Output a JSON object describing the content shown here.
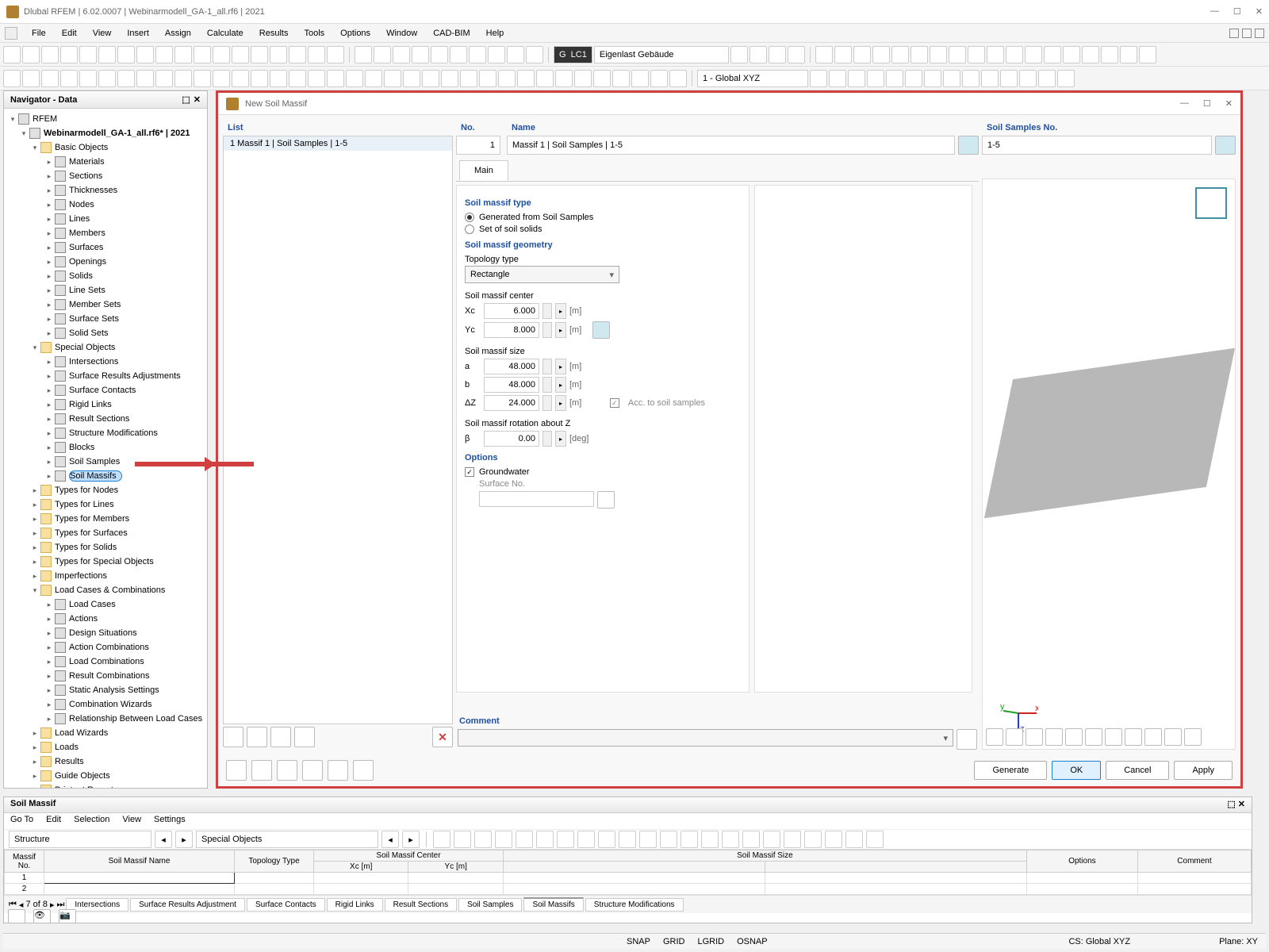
{
  "titlebar": {
    "text": "Dlubal RFEM | 6.02.0007 | Webinarmodell_GA-1_all.rf6 | 2021"
  },
  "menu": {
    "items": [
      "File",
      "Edit",
      "View",
      "Insert",
      "Assign",
      "Calculate",
      "Results",
      "Tools",
      "Options",
      "Window",
      "CAD-BIM",
      "Help"
    ]
  },
  "toolbar1": {
    "lc": "LC1",
    "lc_name": "Eigenlast Gebäude",
    "global": "1 - Global XYZ"
  },
  "navigator": {
    "title": "Navigator - Data",
    "root": "RFEM",
    "model": "Webinarmodell_GA-1_all.rf6* | 2021",
    "groups": {
      "basic": {
        "label": "Basic Objects",
        "items": [
          "Materials",
          "Sections",
          "Thicknesses",
          "Nodes",
          "Lines",
          "Members",
          "Surfaces",
          "Openings",
          "Solids",
          "Line Sets",
          "Member Sets",
          "Surface Sets",
          "Solid Sets"
        ]
      },
      "special": {
        "label": "Special Objects",
        "items": [
          "Intersections",
          "Surface Results Adjustments",
          "Surface Contacts",
          "Rigid Links",
          "Result Sections",
          "Structure Modifications",
          "Blocks",
          "Soil Samples"
        ],
        "selected": "Soil Massifs"
      },
      "types": [
        "Types for Nodes",
        "Types for Lines",
        "Types for Members",
        "Types for Surfaces",
        "Types for Solids",
        "Types for Special Objects",
        "Imperfections"
      ],
      "loadcomb": {
        "label": "Load Cases & Combinations",
        "items": [
          "Load Cases",
          "Actions",
          "Design Situations",
          "Action Combinations",
          "Load Combinations",
          "Result Combinations",
          "Static Analysis Settings",
          "Combination Wizards",
          "Relationship Between Load Cases"
        ]
      },
      "other": [
        "Load Wizards",
        "Loads",
        "Results",
        "Guide Objects",
        "Printout Reports"
      ]
    }
  },
  "dialog": {
    "title": "New Soil Massif",
    "list_header": "List",
    "list_item": "1  Massif 1 | Soil Samples | 1-5",
    "no_label": "No.",
    "no_value": "1",
    "name_label": "Name",
    "name_value": "Massif 1 | Soil Samples | 1-5",
    "samples_label": "Soil Samples No.",
    "samples_value": "1-5",
    "tab_main": "Main",
    "sec_type": "Soil massif type",
    "radio_gen": "Generated from Soil Samples",
    "radio_set": "Set of soil solids",
    "sec_geom": "Soil massif geometry",
    "topo_label": "Topology type",
    "topo_value": "Rectangle",
    "center_label": "Soil massif center",
    "xc_label": "Xc",
    "xc": "6.000",
    "yc_label": "Yc",
    "yc": "8.000",
    "size_label": "Soil massif size",
    "a_label": "a",
    "a": "48.000",
    "b_label": "b",
    "b": "48.000",
    "dz_label": "ΔZ",
    "dz": "24.000",
    "acc_label": "Acc. to soil samples",
    "rot_label": "Soil massif rotation about Z",
    "beta_label": "β",
    "beta": "0.00",
    "deg": "[deg]",
    "m_unit": "[m]",
    "sec_options": "Options",
    "gw": "Groundwater",
    "surf_no": "Surface No.",
    "comment": "Comment",
    "btn_generate": "Generate",
    "btn_ok": "OK",
    "btn_cancel": "Cancel",
    "btn_apply": "Apply"
  },
  "bottom": {
    "title": "Soil Massif",
    "menu": [
      "Go To",
      "Edit",
      "Selection",
      "View",
      "Settings"
    ],
    "sel1": "Structure",
    "sel2": "Special Objects",
    "cols": {
      "no": "Massif\nNo.",
      "name": "Soil Massif Name",
      "topo": "Topology\nType",
      "center": "Soil Massif Center",
      "size": "Soil Massif Size",
      "opts": "Options",
      "comment": "Comment",
      "xc": "Xc [m]",
      "yc": "Yc [m]"
    },
    "rows": [
      "1",
      "2"
    ],
    "page": "7 of 8",
    "tabs": [
      "Intersections",
      "Surface Results Adjustment",
      "Surface Contacts",
      "Rigid Links",
      "Result Sections",
      "Soil Samples",
      "Soil Massifs",
      "Structure Modifications"
    ]
  },
  "status": {
    "snap": "SNAP",
    "grid": "GRID",
    "lgrid": "LGRID",
    "osnap": "OSNAP",
    "cs": "CS: Global XYZ",
    "plane": "Plane: XY"
  }
}
